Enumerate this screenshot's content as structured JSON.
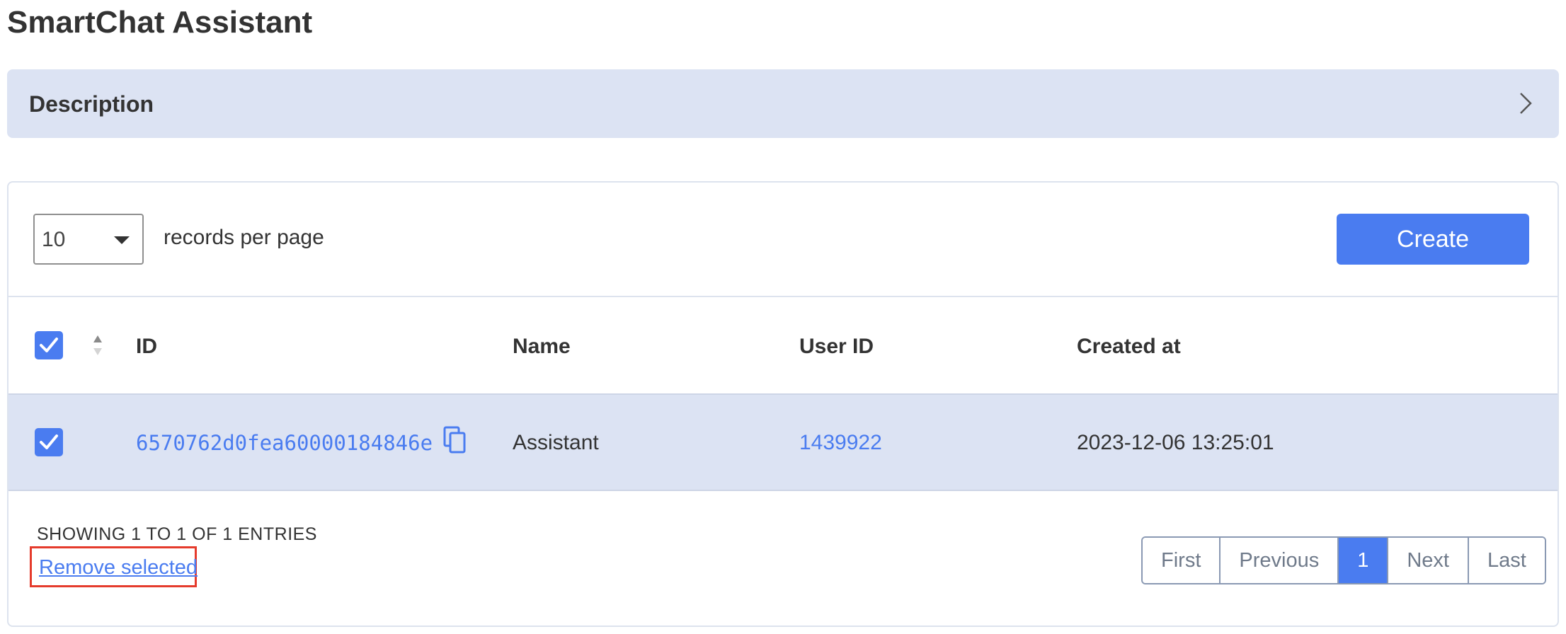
{
  "app": {
    "title": "SmartChat Assistant"
  },
  "description": {
    "label": "Description"
  },
  "toolbar": {
    "per_page_value": "10",
    "per_page_label": "records per page",
    "create_label": "Create"
  },
  "table": {
    "headers": {
      "id": "ID",
      "name": "Name",
      "user_id": "User ID",
      "created_at": "Created at"
    },
    "rows": [
      {
        "id": "6570762d0fea60000184846e",
        "name": "Assistant",
        "user_id": "1439922",
        "created_at": "2023-12-06 13:25:01",
        "selected": true
      }
    ],
    "all_selected": true
  },
  "footer": {
    "entries_info": "SHOWING 1 TO 1 OF 1 ENTRIES",
    "remove_selected": "Remove selected",
    "pagination": {
      "first": "First",
      "previous": "Previous",
      "current": "1",
      "next": "Next",
      "last": "Last"
    }
  },
  "colors": {
    "accent": "#4a7cf0",
    "highlight": "#dce3f3",
    "annotation_box": "#e53b2c"
  }
}
